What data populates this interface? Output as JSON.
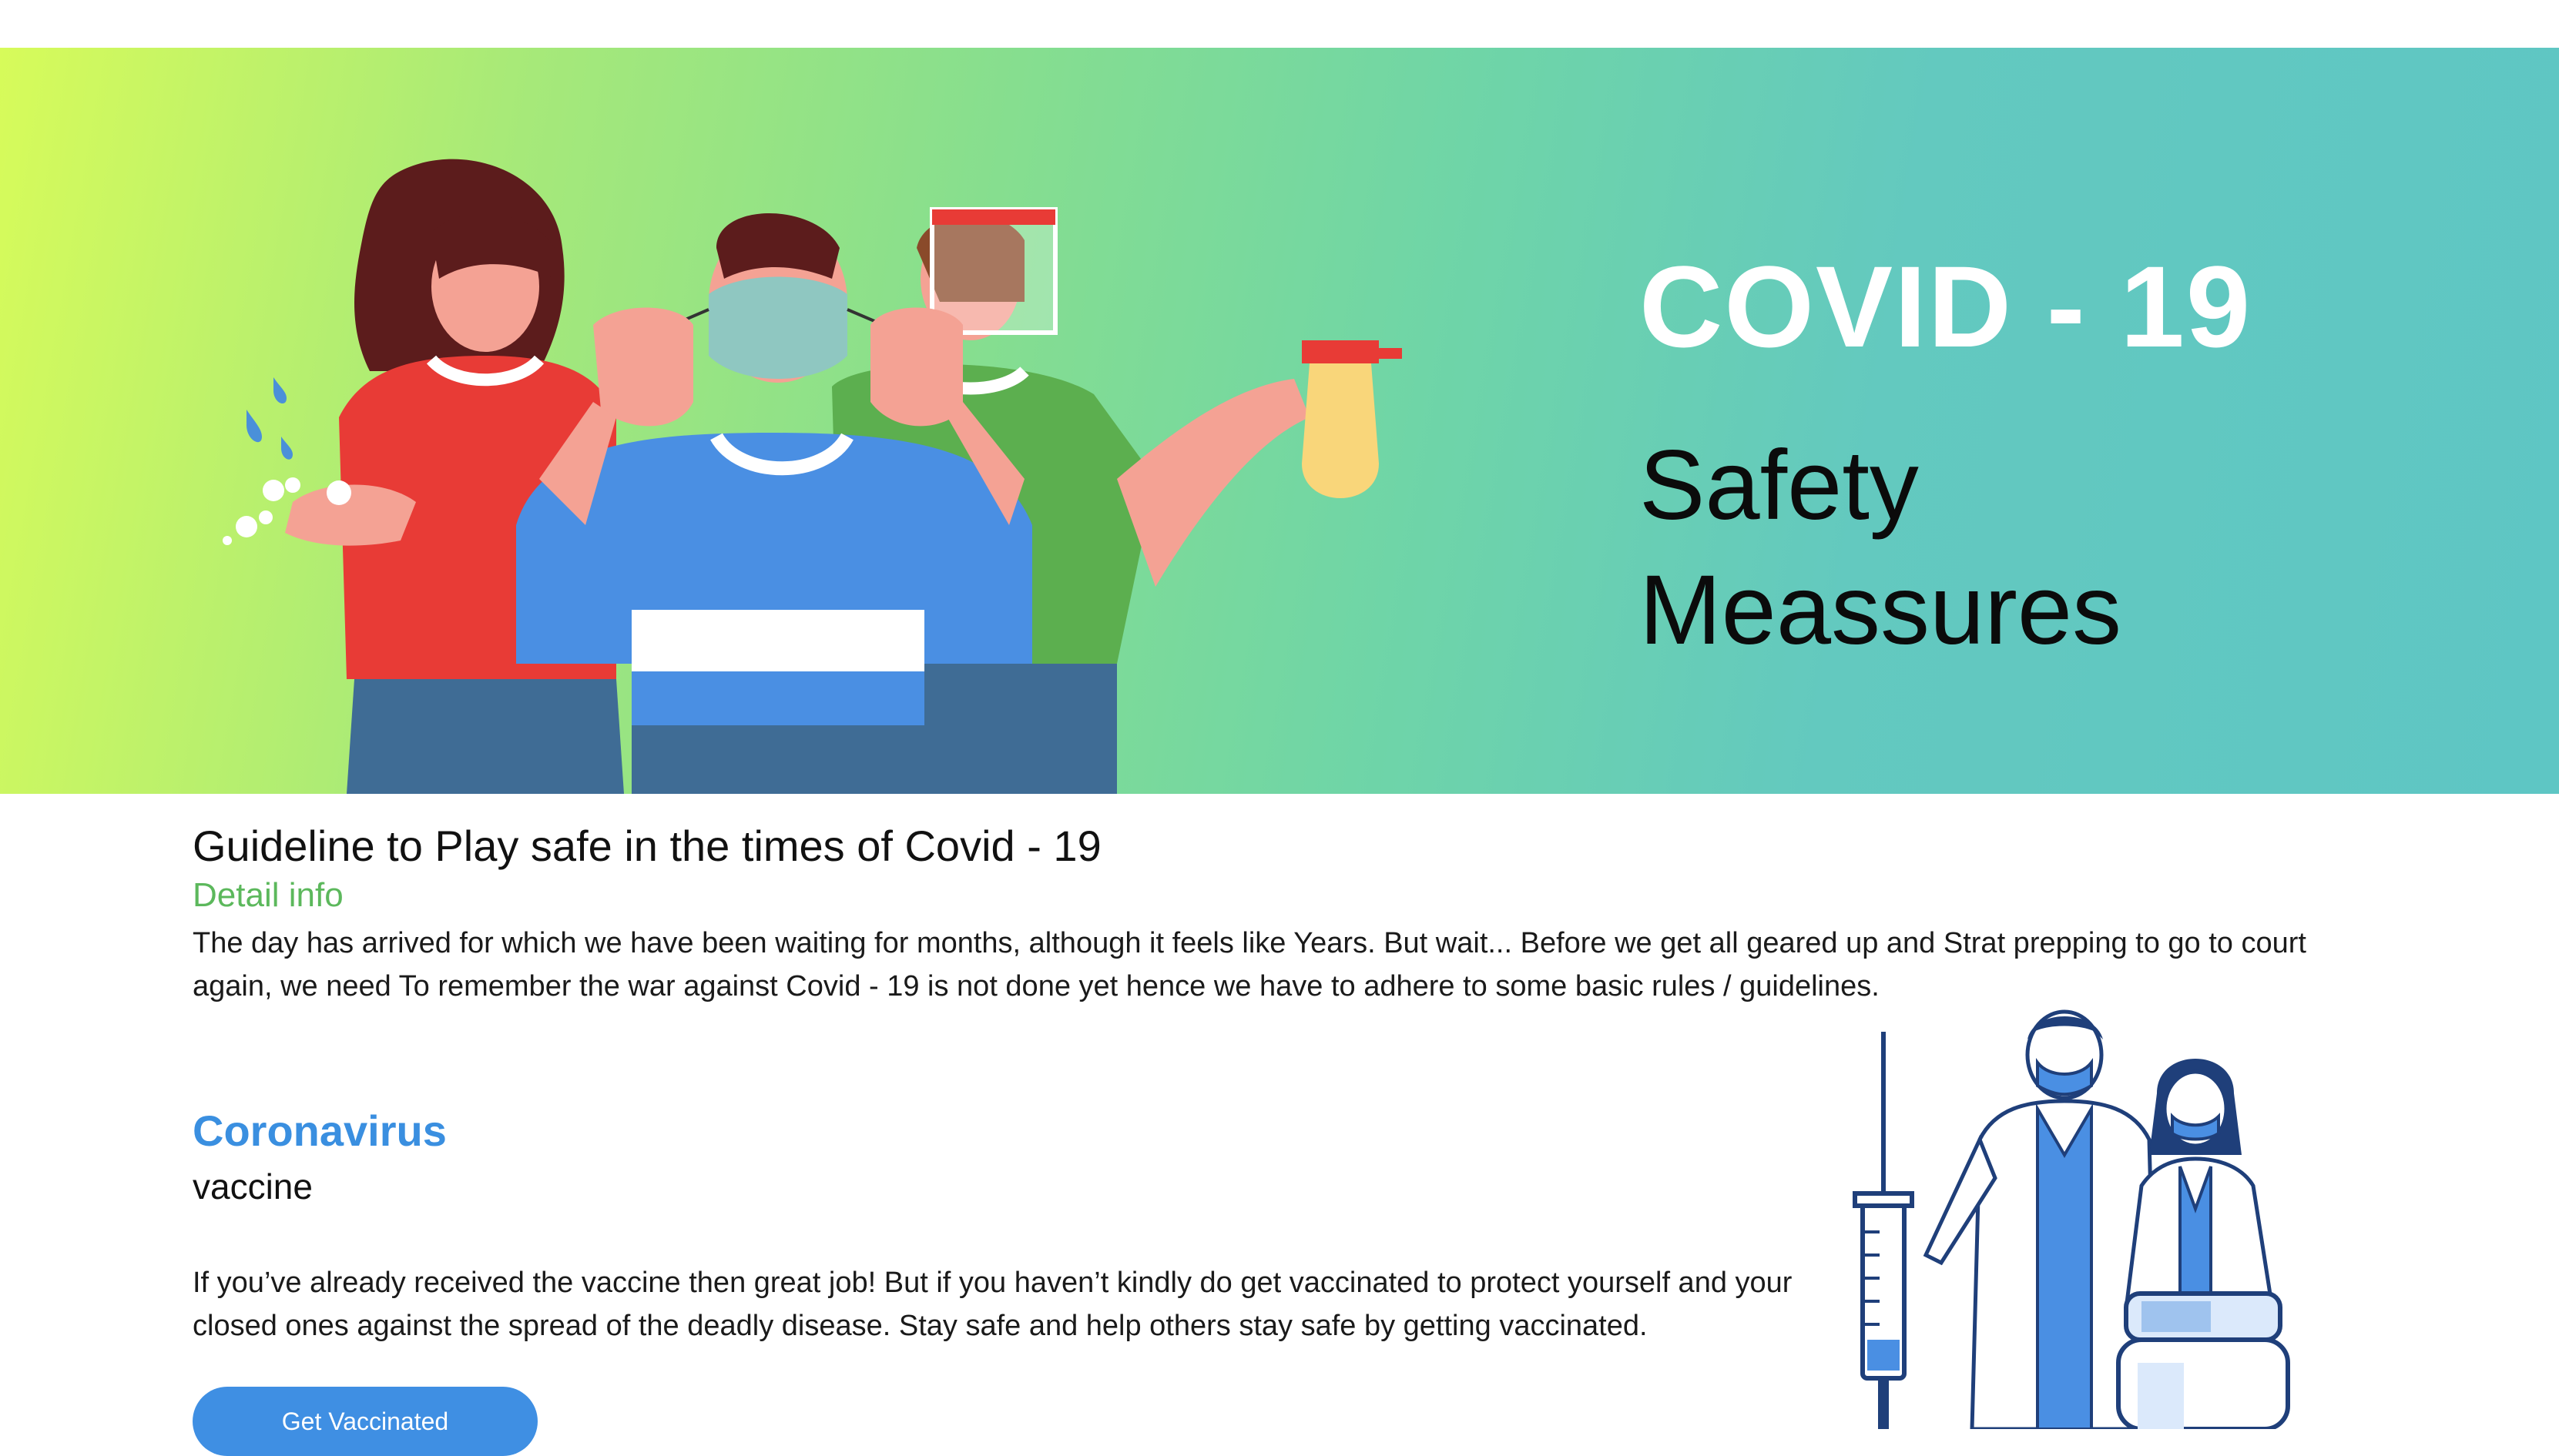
{
  "hero": {
    "title": "COVID - 19",
    "subtitle_line1": "Safety",
    "subtitle_line2": "Meassures"
  },
  "guideline": {
    "title": "Guideline to Play safe in the times of Covid - 19",
    "detail_label": "Detail info",
    "intro": "The day has arrived for which we have been waiting for months, although it feels like Years. But wait... Before we get all geared up and Strat prepping to go to court again, we need To remember the war against Covid - 19 is not done yet hence we have to adhere to some basic rules / guidelines."
  },
  "vaccine_section": {
    "heading": "Coronavirus",
    "subheading": "vaccine",
    "body": "If you’ve already received the vaccine then great job! But if you haven’t kindly do get vaccinated to protect yourself and your closed ones against the spread of the deadly disease. Stay safe and help others stay safe by getting vaccinated.",
    "button_label": "Get Vaccinated"
  },
  "colors": {
    "accent_blue": "#3f8fe3",
    "accent_green": "#5cb85c",
    "hero_gradient_start": "#d7fb5a",
    "hero_gradient_end": "#5ec6c4"
  },
  "icons": [
    "hand-washing-icon",
    "face-mask-icon",
    "face-shield-icon",
    "spray-bottle-icon",
    "syringe-icon",
    "vaccine-vial-icon"
  ]
}
